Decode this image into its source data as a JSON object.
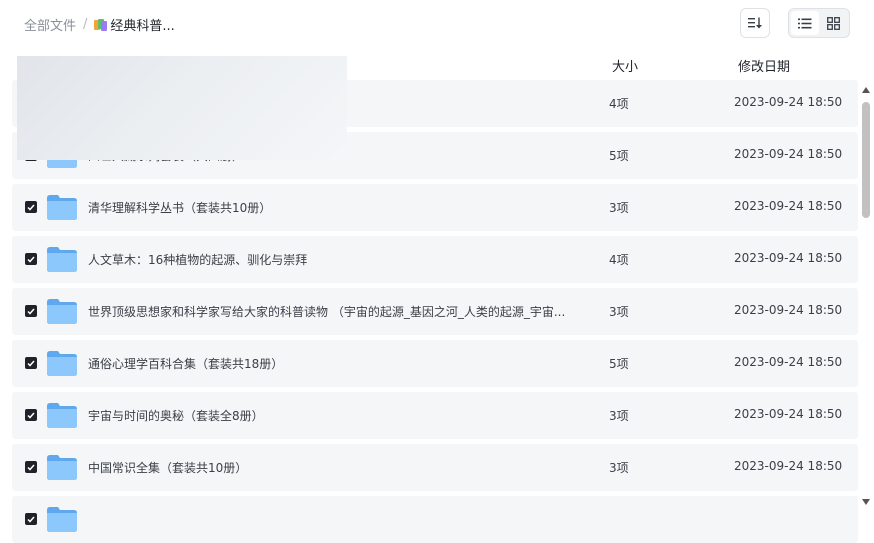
{
  "breadcrumb": {
    "root": "全部文件",
    "separator": "/",
    "current": "经典科普..."
  },
  "toolbar": {
    "sort_icon": "sort-icon",
    "list_view_icon": "list-view-icon",
    "grid_view_icon": "grid-view-icon"
  },
  "columns": {
    "size": "大小",
    "modified": "修改日期"
  },
  "rows": [
    {
      "name": "",
      "size": "4项",
      "date": "2023-09-24 18:50"
    },
    {
      "name": "四世兴藏系列套装（共四册）",
      "size": "5项",
      "date": "2023-09-24 18:50"
    },
    {
      "name": "清华理解科学丛书（套装共10册）",
      "size": "3项",
      "date": "2023-09-24 18:50"
    },
    {
      "name": "人文草木：16种植物的起源、驯化与崇拜",
      "size": "4项",
      "date": "2023-09-24 18:50"
    },
    {
      "name": "世界顶级思想家和科学家写给大家的科普读物 （宇宙的起源_基因之河_人类的起源_宇宙...",
      "size": "3项",
      "date": "2023-09-24 18:50"
    },
    {
      "name": "通俗心理学百科合集（套装共18册）",
      "size": "5项",
      "date": "2023-09-24 18:50"
    },
    {
      "name": "宇宙与时间的奥秘（套装全8册）",
      "size": "3项",
      "date": "2023-09-24 18:50"
    },
    {
      "name": "中国常识全集（套装共10册）",
      "size": "3项",
      "date": "2023-09-24 18:50"
    },
    {
      "name": "",
      "size": "",
      "date": ""
    }
  ],
  "colors": {
    "row_bg": "#f5f6f7",
    "folder_blue": "#7cbcf7",
    "checkbox": "#1f2329",
    "muted_text": "#8a8f99"
  }
}
